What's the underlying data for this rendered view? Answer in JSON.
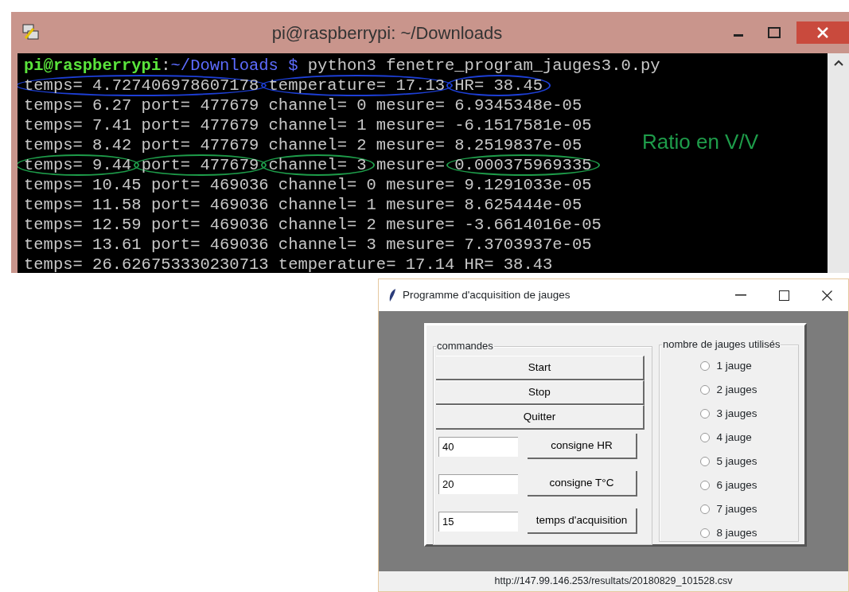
{
  "terminal": {
    "title": "pi@raspberrypi: ~/Downloads",
    "lines": [
      {
        "segments": [
          {
            "kind": "user",
            "text": "pi@raspberrypi"
          },
          {
            "kind": "output",
            "text": ":"
          },
          {
            "kind": "path",
            "text": "~/Downloads $"
          },
          {
            "kind": "output",
            "text": " python3 fenetre_program_jauges3.0.py"
          }
        ]
      },
      {
        "segments": [
          {
            "kind": "output",
            "text": "temps= 4.727406978607178",
            "color": "#1d3fd6"
          },
          {
            "kind": "output",
            "text": "temperature= 17.13",
            "color": "#1d3fd6"
          },
          {
            "kind": "output",
            "text": "HR= 38.45",
            "color": "#1d3fd6"
          }
        ]
      },
      {
        "segments": [
          {
            "kind": "output",
            "text": "temps= 6.27 port= 477679 channel= 0 mesure= 6.9345348e-05"
          }
        ]
      },
      {
        "segments": [
          {
            "kind": "output",
            "text": "temps= 7.41 port= 477679 channel= 1 mesure= -6.1517581e-05"
          }
        ]
      },
      {
        "segments": [
          {
            "kind": "output",
            "text": "temps= 8.42 port= 477679 channel= 2 mesure= 8.2519837e-05"
          }
        ]
      },
      {
        "segments": [
          {
            "kind": "output",
            "text": "temps= 9.44",
            "color": "#1e9c4a"
          },
          {
            "kind": "output",
            "text": "port= 477679",
            "color": "#1e9c4a"
          },
          {
            "kind": "output",
            "text": "channel= 3",
            "color": "#1e9c4a"
          },
          {
            "kind": "output",
            "text": " mesure= "
          },
          {
            "kind": "output",
            "text": "0.000375969335",
            "color": "#1e9c4a"
          }
        ]
      },
      {
        "segments": [
          {
            "kind": "output",
            "text": "temps= 10.45 port= 469036 channel= 0 mesure= 9.1291033e-05"
          }
        ]
      },
      {
        "segments": [
          {
            "kind": "output",
            "text": "temps= 11.58 port= 469036 channel= 1 mesure= 8.625444e-05"
          }
        ]
      },
      {
        "segments": [
          {
            "kind": "output",
            "text": "temps= 12.59 port= 469036 channel= 2 mesure= -3.6614016e-05"
          }
        ]
      },
      {
        "segments": [
          {
            "kind": "output",
            "text": "temps= 13.61 port= 469036 channel= 3 mesure= 7.3703937e-05"
          }
        ]
      },
      {
        "segments": [
          {
            "kind": "output",
            "text": "temps= 26.626753330230713 temperature= 17.14 HR= 38.43"
          }
        ]
      }
    ],
    "annotation": "Ratio en V/V"
  },
  "app": {
    "title": "Programme d'acquisition de jauges",
    "commands": {
      "label": "commandes",
      "buttons": [
        "Start",
        "Stop",
        "Quitter"
      ],
      "settings": [
        {
          "value": "40",
          "button": "consigne HR"
        },
        {
          "value": "20",
          "button": "consigne T°C"
        },
        {
          "value": "15",
          "button": "temps d'acquisition"
        }
      ]
    },
    "gauges": {
      "label": "nombre de jauges utilisés",
      "options": [
        {
          "label": "1 jauge",
          "selected": false
        },
        {
          "label": "2 jauges",
          "selected": false
        },
        {
          "label": "3 jauges",
          "selected": false
        },
        {
          "label": "4 jauge",
          "selected": false
        },
        {
          "label": "5 jauges",
          "selected": false
        },
        {
          "label": "6 jauges",
          "selected": false
        },
        {
          "label": "7 jauges",
          "selected": false
        },
        {
          "label": "8 jauges",
          "selected": false
        }
      ]
    },
    "status": "http://147.99.146.253/resultats/20180829_101528.csv"
  }
}
